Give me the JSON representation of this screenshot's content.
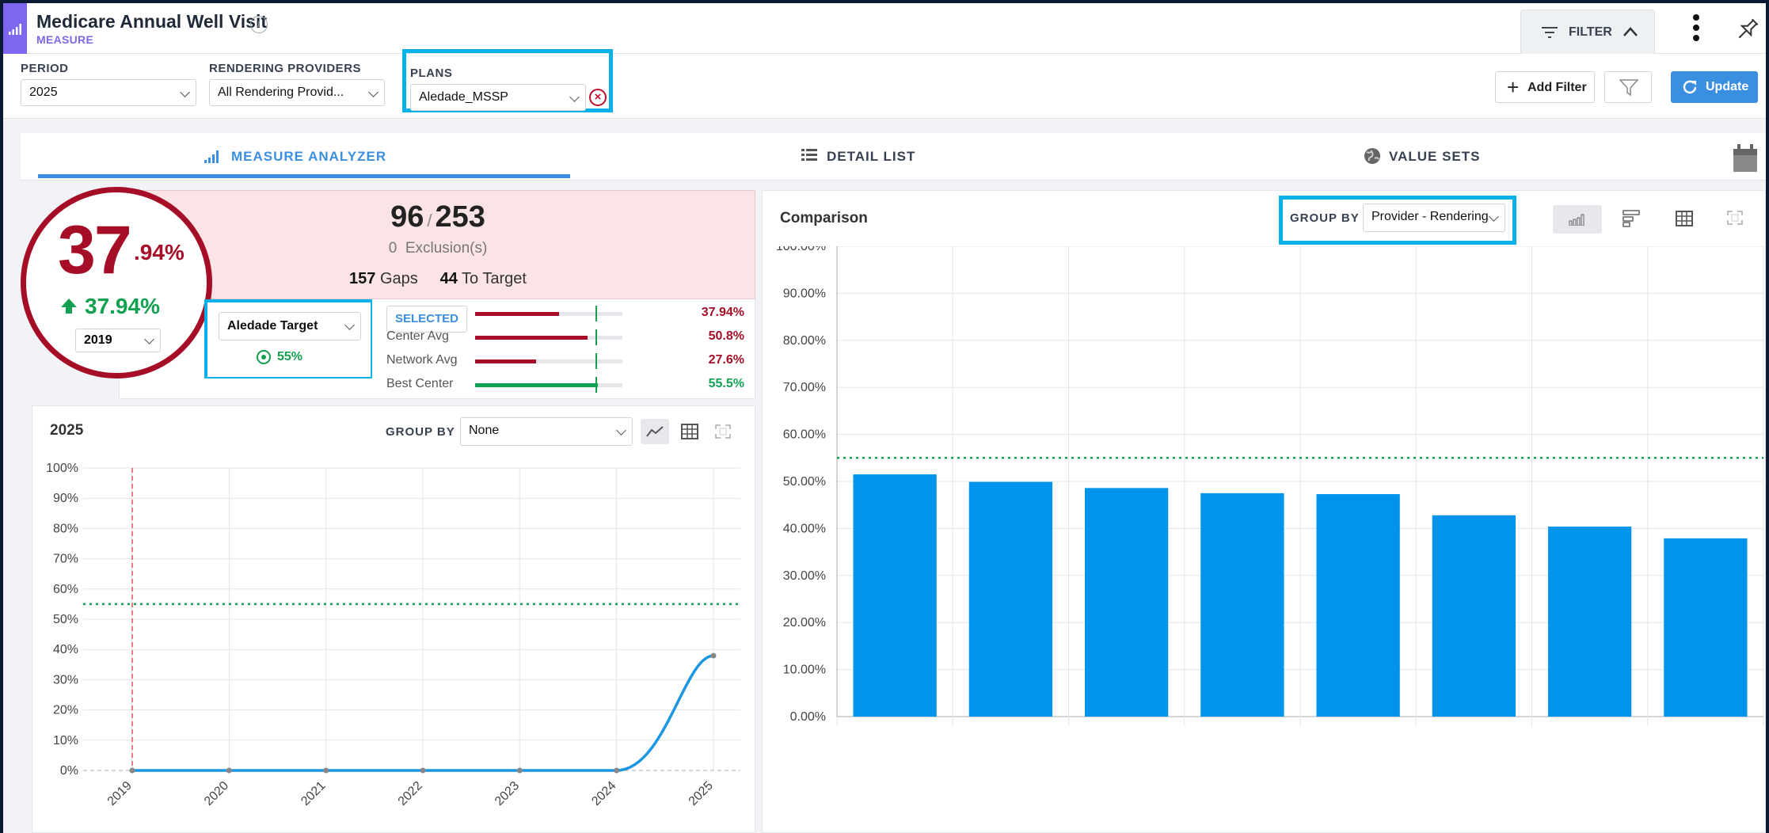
{
  "header": {
    "title": "Medicare Annual Well Visit",
    "subtitle": "MEASURE",
    "filter_label": "FILTER"
  },
  "filters": {
    "period_label": "PERIOD",
    "period_value": "2025",
    "providers_label": "RENDERING PROVIDERS",
    "providers_value": "All Rendering Provid...",
    "plans_label": "PLANS",
    "plans_value": "Aledade_MSSP",
    "add_filter_label": "Add Filter",
    "update_label": "Update"
  },
  "tabs": [
    {
      "label": "MEASURE ANALYZER",
      "active": true
    },
    {
      "label": "DETAIL LIST",
      "active": false
    },
    {
      "label": "VALUE SETS",
      "active": false
    }
  ],
  "score": {
    "value_int": "37",
    "value_dec": ".94%",
    "trend": "37.94%",
    "year": "2019"
  },
  "summary": {
    "numerator": "96",
    "denominator": "253",
    "exclusions_count": "0",
    "exclusions_label": "Exclusion(s)",
    "gaps_count": "157",
    "gaps_label": "Gaps",
    "to_target_count": "44",
    "to_target_label": "To Target"
  },
  "target": {
    "select_value": "Aledade Target",
    "value": "55%"
  },
  "benchmarks": [
    {
      "label": "SELECTED",
      "value": "37.94%",
      "fraction": 0.3794,
      "color": "#a50e26"
    },
    {
      "label": "Center Avg",
      "value": "50.8%",
      "fraction": 0.508,
      "color": "#a50e26"
    },
    {
      "label": "Network Avg",
      "value": "27.6%",
      "fraction": 0.276,
      "color": "#a50e26"
    },
    {
      "label": "Best Center",
      "value": "55.5%",
      "fraction": 0.555,
      "color": "#11a150"
    }
  ],
  "trend_panel": {
    "title": "2025",
    "group_by_label": "GROUP BY",
    "group_by_value": "None"
  },
  "comparison_panel": {
    "title": "Comparison",
    "group_by_label": "GROUP BY",
    "group_by_value": "Provider - Rendering"
  },
  "colors": {
    "accent": "#3b8fe0",
    "danger": "#a50e26",
    "success": "#11a150",
    "bar": "#0094ea",
    "highlight": "#0ab0e8"
  },
  "chart_data": [
    {
      "type": "line",
      "title": "2025",
      "x": [
        "2019",
        "2020",
        "2021",
        "2022",
        "2023",
        "2024",
        "2025"
      ],
      "y_ticks": [
        "0%",
        "10%",
        "20%",
        "30%",
        "40%",
        "50%",
        "60%",
        "70%",
        "80%",
        "90%",
        "100%"
      ],
      "ylim": [
        0,
        100
      ],
      "series": [
        {
          "values": [
            0,
            0,
            0,
            0,
            0,
            0,
            37.94
          ]
        }
      ],
      "target_line": 55,
      "marker_x": "2019",
      "grid": true
    },
    {
      "type": "bar",
      "title": "Comparison",
      "categories": [
        "",
        "",
        "",
        "",
        "",
        "",
        "",
        ""
      ],
      "values": [
        51.5,
        49.9,
        48.6,
        47.5,
        47.3,
        42.8,
        40.4,
        37.9
      ],
      "y_ticks": [
        "0.00%",
        "10.00%",
        "20.00%",
        "30.00%",
        "40.00%",
        "50.00%",
        "60.00%",
        "70.00%",
        "80.00%",
        "90.00%",
        "100.00%"
      ],
      "ylim": [
        0,
        100
      ],
      "target_line": 55,
      "grid": true
    }
  ]
}
